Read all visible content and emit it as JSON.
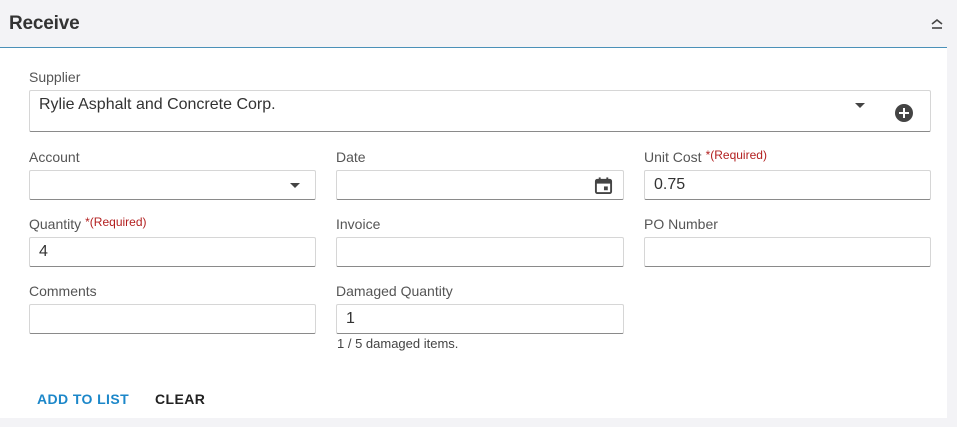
{
  "header": {
    "title": "Receive",
    "collapse_icon": "chevron-up-icon"
  },
  "form": {
    "supplier": {
      "label": "Supplier",
      "value": "Rylie Asphalt and Concrete Corp."
    },
    "account": {
      "label": "Account",
      "value": ""
    },
    "date": {
      "label": "Date",
      "value": ""
    },
    "unit_cost": {
      "label": "Unit Cost",
      "required": "*(Required)",
      "value": "0.75"
    },
    "quantity": {
      "label": "Quantity",
      "required": "*(Required)",
      "value": "4"
    },
    "invoice": {
      "label": "Invoice",
      "value": ""
    },
    "po_number": {
      "label": "PO Number",
      "value": ""
    },
    "comments": {
      "label": "Comments",
      "value": ""
    },
    "damaged_quantity": {
      "label": "Damaged Quantity",
      "value": "1",
      "hint": "1 / 5 damaged items."
    }
  },
  "actions": {
    "add_to_list": "ADD TO LIST",
    "clear": "CLEAR"
  },
  "colors": {
    "accent": "#1c87c9",
    "required": "#b32020",
    "header_line": "#4a90b8"
  }
}
